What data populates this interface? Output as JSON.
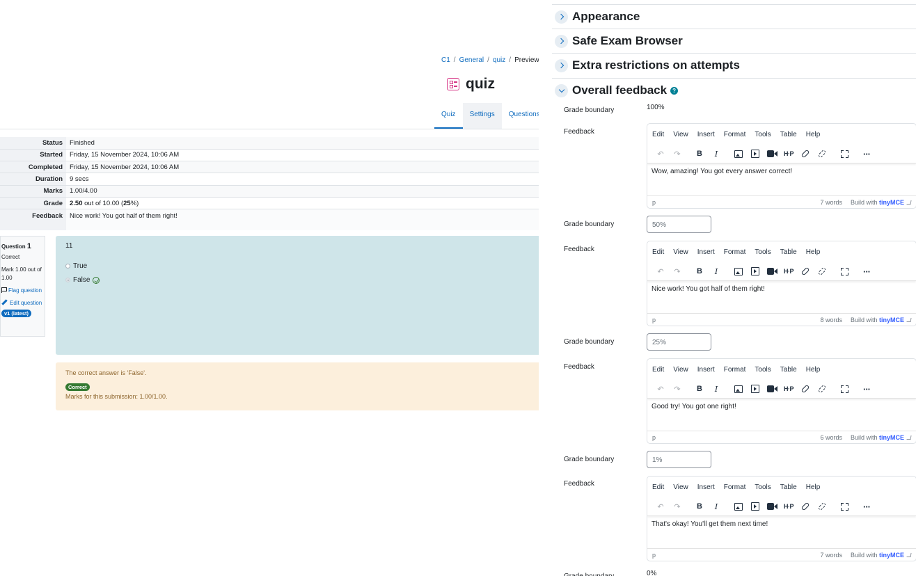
{
  "breadcrumb": [
    "C1",
    "General",
    "quiz",
    "Preview"
  ],
  "page_title": "quiz",
  "tabs": [
    "Quiz",
    "Settings",
    "Questions"
  ],
  "summary": [
    {
      "label": "Status",
      "value": "Finished"
    },
    {
      "label": "Started",
      "value": "Friday, 15 November 2024, 10:06 AM"
    },
    {
      "label": "Completed",
      "value": "Friday, 15 November 2024, 10:06 AM"
    },
    {
      "label": "Duration",
      "value": "9 secs"
    },
    {
      "label": "Marks",
      "value": "1.00/4.00"
    },
    {
      "label": "Grade",
      "value_bold": "2.50",
      "value_mid": " out of 10.00 (",
      "value_pct": "25",
      "value_tail": "%)"
    },
    {
      "label": "Feedback",
      "value": "Nice work! You got half of them right!"
    }
  ],
  "question": {
    "label": "Question",
    "number": "1",
    "state": "Correct",
    "mark": "Mark 1.00 out of 1.00",
    "flag": "Flag question",
    "edit": "Edit question",
    "version": "v1 (latest)",
    "text": "11",
    "options": [
      "True",
      "False"
    ],
    "selected": "False"
  },
  "outcome": {
    "right_answer": "The correct answer is 'False'.",
    "badge": "Correct",
    "marks": "Marks for this submission: 1.00/1.00."
  },
  "sections": [
    "Appearance",
    "Safe Exam Browser",
    "Extra restrictions on attempts",
    "Overall feedback"
  ],
  "form": {
    "grade_boundary_label": "Grade boundary",
    "feedback_label": "Feedback",
    "first_boundary": "100%",
    "last_boundary": "0%",
    "boundaries": [
      "50%",
      "25%",
      "1%"
    ]
  },
  "editor": {
    "menus": [
      "Edit",
      "View",
      "Insert",
      "Format",
      "Tools",
      "Table",
      "Help"
    ],
    "path": "p",
    "brand_prefix": "Build with",
    "brand_name": "tinyMCE"
  },
  "feedbacks": [
    {
      "text": "Wow, amazing! You got every answer correct!",
      "words": "7 words"
    },
    {
      "text": "Nice work! You got half of them right!",
      "words": "8 words"
    },
    {
      "text": "Good try! You got one right!",
      "words": "6 words"
    },
    {
      "text": "That's okay! You'll get them next time!",
      "words": "7 words"
    }
  ],
  "colors": {
    "brand": "#0f6cbf",
    "correct": "#357a32",
    "question_bg": "#cfe5e9",
    "outcome_bg": "#fcefdc"
  }
}
